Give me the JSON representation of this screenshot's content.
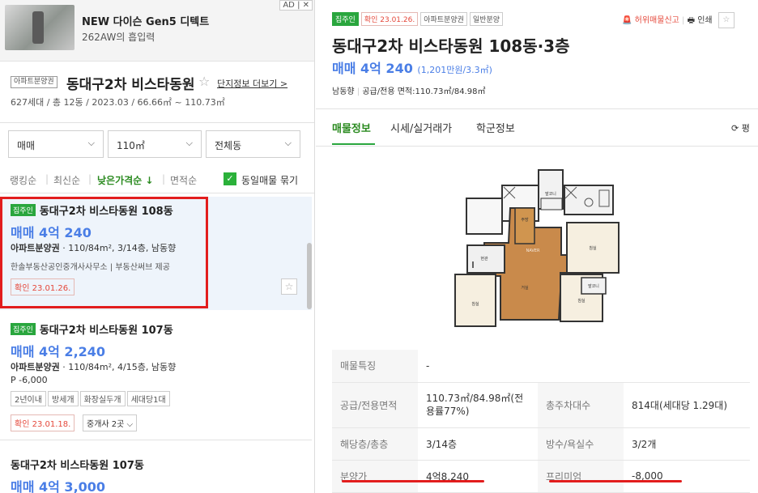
{
  "ad": {
    "title": "NEW 다이슨 Gen5 디텍트",
    "subtitle": "262AW의 흡입력",
    "badge": "AD | ✕"
  },
  "complex": {
    "badge": "아파트분양권",
    "name": "동대구2차 비스타동원",
    "star": "☆",
    "more_link": "단지정보 더보기 >",
    "meta": "627세대 / 총 12동 / 2023.03 / 66.66㎡ ~ 110.73㎡"
  },
  "filters": {
    "trade": "매매",
    "area": "110㎡",
    "dong": "전체동"
  },
  "sort": {
    "options": [
      "랭킹순",
      "최신순",
      "낮은가격순 ↓",
      "면적순"
    ],
    "dedupe_label": "동일매물 묶기",
    "dedupe_checked": true
  },
  "listings": [
    {
      "tag": "집주인",
      "title": "동대구2차 비스타동원 108동",
      "price": "매매 4억 240",
      "type": "아파트분양권",
      "spec": " · 110/84m², 3/14층, 남동향",
      "agency": "한솔부동산공인중개사사무소 | 부동산써브 제공",
      "confirm": "확인 23.01.26."
    },
    {
      "tag": "집주인",
      "title": "동대구2차 비스타동원 107동",
      "price": "매매 4억 2,240",
      "type": "아파트분양권",
      "spec": " · 110/84m², 4/15층, 남동향",
      "premium": "P -6,000",
      "pills": [
        "2년이내",
        "방세개",
        "화장실두개",
        "세대당1대"
      ],
      "confirm": "확인 23.01.18.",
      "agents": "중개사 2곳 ⌵"
    },
    {
      "title": "동대구2차 비스타동원 107동",
      "price": "매매 4억 3,000"
    }
  ],
  "detail": {
    "tags": [
      "집주인",
      "확인 23.01.26.",
      "아파트분양권",
      "일반분양"
    ],
    "report": "허위매물신고",
    "print": "인쇄",
    "star": "☆",
    "title": "동대구2차 비스타동원 108동·3층",
    "price": "매매 4억 240",
    "price_per": "(1,201만원/3.3㎡)",
    "direction": "남동향",
    "area_info": "공급/전용 면적:110.73㎡/84.98㎡",
    "tabs": [
      "매물정보",
      "시세/실거래가",
      "학군정보"
    ],
    "refresh": "⟳ 평",
    "table": [
      {
        "k1": "매물특징",
        "v1": "-",
        "k2": "",
        "v2": ""
      },
      {
        "k1": "공급/전용면적",
        "v1": "110.73㎡/84.98㎡(전용률77%)",
        "k2": "총주차대수",
        "v2": "814대(세대당 1.29대)"
      },
      {
        "k1": "해당층/총층",
        "v1": "3/14층",
        "k2": "방수/욕실수",
        "v2": "3/2개"
      },
      {
        "k1": "분양가",
        "v1": "4억8,240",
        "k2": "프리미엄",
        "v2": "-8,000"
      }
    ]
  },
  "colors": {
    "price_blue": "#4a7ee6",
    "accent_green": "#2aa63e",
    "highlight_red": "#e21d1d"
  }
}
